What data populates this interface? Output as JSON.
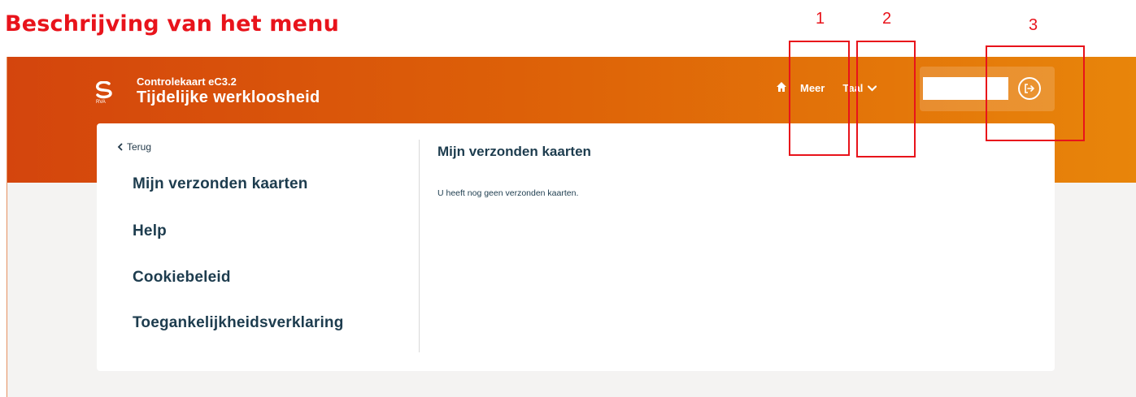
{
  "heading": "Beschrijving van het menu",
  "app": {
    "subtitle": "Controlekaart eC3.2",
    "title": "Tijdelijke werkloosheid",
    "logo_text": "RVA"
  },
  "nav": {
    "home_icon": "home-icon",
    "meer_label": "Meer",
    "taal_label": "Taal",
    "user_value": "",
    "logout_icon": "logout-icon"
  },
  "sidebar": {
    "back_label": "Terug",
    "items": [
      {
        "label": "Mijn verzonden kaarten"
      },
      {
        "label": "Help"
      },
      {
        "label": "Cookiebeleid"
      },
      {
        "label": "Toegankelijkheidsverklaring"
      }
    ]
  },
  "main": {
    "title": "Mijn verzonden kaarten",
    "message": "U heeft nog geen verzonden kaarten."
  },
  "annotations": [
    {
      "label": "1"
    },
    {
      "label": "2"
    },
    {
      "label": "3"
    }
  ],
  "colors": {
    "annotation": "#e8131b",
    "banner_start": "#d4450d",
    "banner_end": "#e8850a",
    "text_dark": "#1d3c4e"
  }
}
